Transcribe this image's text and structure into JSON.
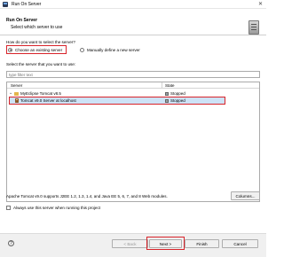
{
  "window": {
    "title": "Run On Server"
  },
  "header": {
    "title": "Run On Server",
    "subtitle": "Select which server to use"
  },
  "selection": {
    "question": "How do you want to select the server?",
    "option_existing": "Choose an existing server",
    "option_manual": "Manually define a new server",
    "selected": "existing"
  },
  "filter": {
    "label": "Select the server that you want to use:",
    "placeholder": "type filter text"
  },
  "table": {
    "columns": {
      "server": "Server",
      "state": "State"
    },
    "rows": [
      {
        "server": "MyEclipse Tomcat v8.5",
        "state": "Stopped",
        "selected": false
      },
      {
        "server": "Tomcat v9.0 Server at localhost",
        "state": "Stopped",
        "selected": true
      }
    ]
  },
  "description": "Apache Tomcat v9.0 supports J2EE 1.2, 1.3, 1.4, and Java EE 5, 6, 7, and 8 Web modules.",
  "columns_button": "Columns...",
  "always_checkbox": {
    "label": "Always use this server when running this project",
    "checked": false
  },
  "footer": {
    "help_icon": "question-mark-icon",
    "back": "< Back",
    "next": "Next >",
    "finish": "Finish",
    "cancel": "Cancel"
  },
  "colors": {
    "highlight_red": "#d8232a",
    "selection_blue": "#cde3f7"
  }
}
